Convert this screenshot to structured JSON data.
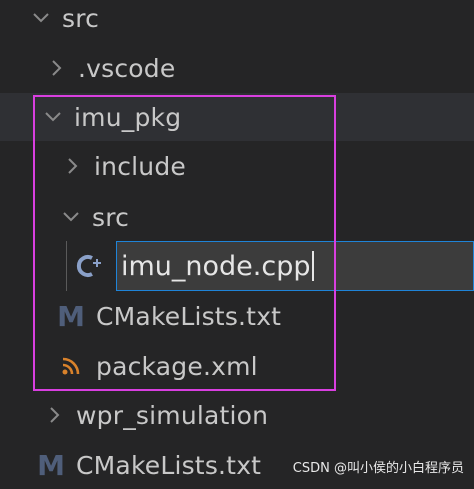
{
  "tree": {
    "src_root": {
      "label": "src",
      "expanded": true
    },
    "vscode": {
      "label": ".vscode",
      "expanded": false
    },
    "imu_pkg": {
      "label": "imu_pkg",
      "expanded": true
    },
    "include": {
      "label": "include",
      "expanded": false
    },
    "src_inner": {
      "label": "src",
      "expanded": true
    },
    "rename_input": {
      "value": "imu_node.cpp",
      "icon": "cpp-file-icon"
    },
    "pkg_cmakelists": {
      "label": "CMakeLists.txt",
      "icon": "cmake-icon"
    },
    "package_xml": {
      "label": "package.xml",
      "icon": "rss-xml-icon"
    },
    "wpr_simulation": {
      "label": "wpr_simulation",
      "expanded": false
    },
    "root_cmakelists": {
      "label": "CMakeLists.txt",
      "icon": "cmake-icon"
    }
  },
  "colors": {
    "background": "#252526",
    "selected_row": "#2f3034",
    "input_border": "#1f84d8",
    "highlight_annotation": "#d93fe0"
  },
  "watermark": "CSDN @叫小侯的小白程序员"
}
